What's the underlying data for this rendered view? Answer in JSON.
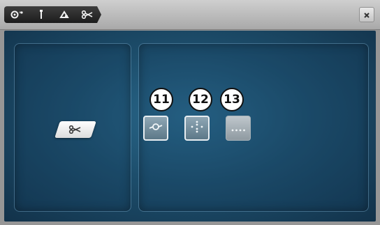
{
  "header": {
    "breadcrumbs": [
      {
        "icon": "thread-tension-icon"
      },
      {
        "icon": "needle-icon"
      },
      {
        "icon": "presser-foot-icon"
      },
      {
        "icon": "scissors-icon"
      }
    ],
    "close_icon": "close-icon"
  },
  "left_panel": {
    "cutter_button_icon": "scissors-icon"
  },
  "right_panel": {
    "callouts": [
      {
        "label": "11",
        "icon": "thread-cut-knot-icon",
        "selected": true
      },
      {
        "label": "12",
        "icon": "dotted-cross-icon",
        "selected": true
      },
      {
        "label": "13",
        "icon": "dotted-line-icon",
        "selected": false
      }
    ]
  },
  "colors": {
    "panel_bg": "#1d4e6c",
    "header_bg": "#bdbdbd",
    "crumb_bg": "#2a2a2a"
  }
}
